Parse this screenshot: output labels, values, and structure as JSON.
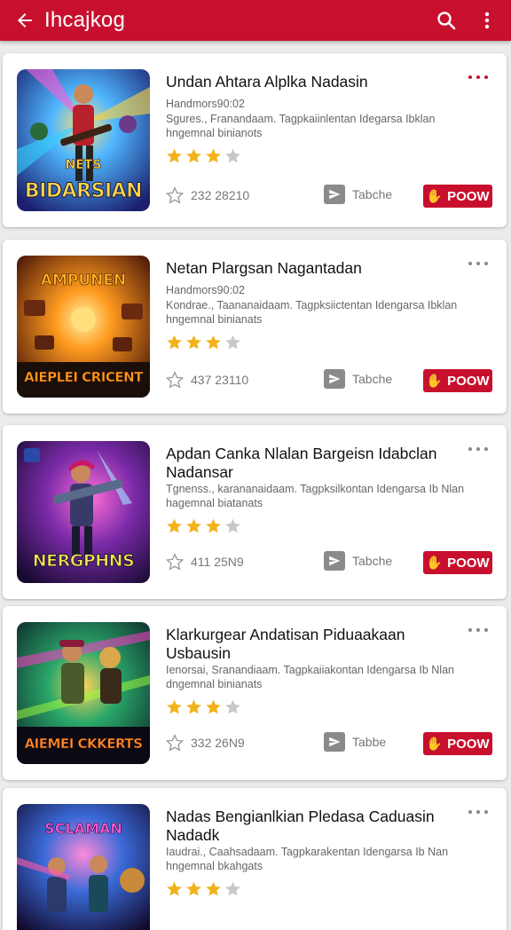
{
  "appbar": {
    "title": "Ihcajkog",
    "back_icon": "arrow-left-icon",
    "search_icon": "search-icon",
    "menu_icon": "more-vert-icon"
  },
  "colors": {
    "accent": "#c8102e",
    "star": "#f2b21b",
    "star_empty": "#c8c8c8"
  },
  "cards": [
    {
      "title": "Undan Ahtara Alplka Nadasin",
      "publisher": "Handmors90:02",
      "desc": "Sgures., Franandaam. Tagpkaiinlentan Idegarsa Ibklan hngemnal binianots",
      "rating": 3,
      "count": "232 28210",
      "tag": "Tabche",
      "button": "POOW",
      "thumb_top": "NETS",
      "thumb_text": "BIDARSIAN",
      "more_active": true
    },
    {
      "title": "Netan Plargsan Nagantadan",
      "publisher": "Handmors90:02",
      "desc": "Kondrae., Taananaidaam. Tagpksiictentan Idengarsa Ibklan hngemnal binianats",
      "rating": 3,
      "count": "437 23110",
      "tag": "Tabche",
      "button": "POOW",
      "thumb_top": "AMPUNEN",
      "thumb_text": "AIEPLEI CRICENT",
      "more_active": false
    },
    {
      "title": "Apdan Canka Nlalan Bargeisn Idabclan Nadansar",
      "publisher": "",
      "desc": "Tgnenss., karananaidaam. Tagpksilkontan Idengarsa Ib Nlan hagemnal biatanats",
      "rating": 3,
      "count": "411 25N9",
      "tag": "Tabche",
      "button": "POOW",
      "thumb_top": "",
      "thumb_text": "NERGPHNS",
      "more_active": false
    },
    {
      "title": "Klarkurgear Andatisan Piduaakaan Usbausin",
      "publisher": "",
      "desc": "Ienorsai, Sranandiaam. Tagpkaiiakontan Idengarsa Ib Nlan dngemnal binianats",
      "rating": 3,
      "count": "332 26N9",
      "tag": "Tabbe",
      "button": "POOW",
      "thumb_top": "",
      "thumb_text": "AIEMEI CKKERTS",
      "more_active": false
    },
    {
      "title": "Nadas Bengianlkian Pledasa Caduasin Nadadk",
      "publisher": "",
      "desc": "Iaudrai., Caahsadaam. Tagpkarakentan Idengarsa Ib Nan hngemnal bkahgats",
      "rating": 3,
      "count": "",
      "tag": "",
      "button": "",
      "thumb_top": "SCLAMAN",
      "thumb_text": "",
      "more_active": false
    }
  ]
}
